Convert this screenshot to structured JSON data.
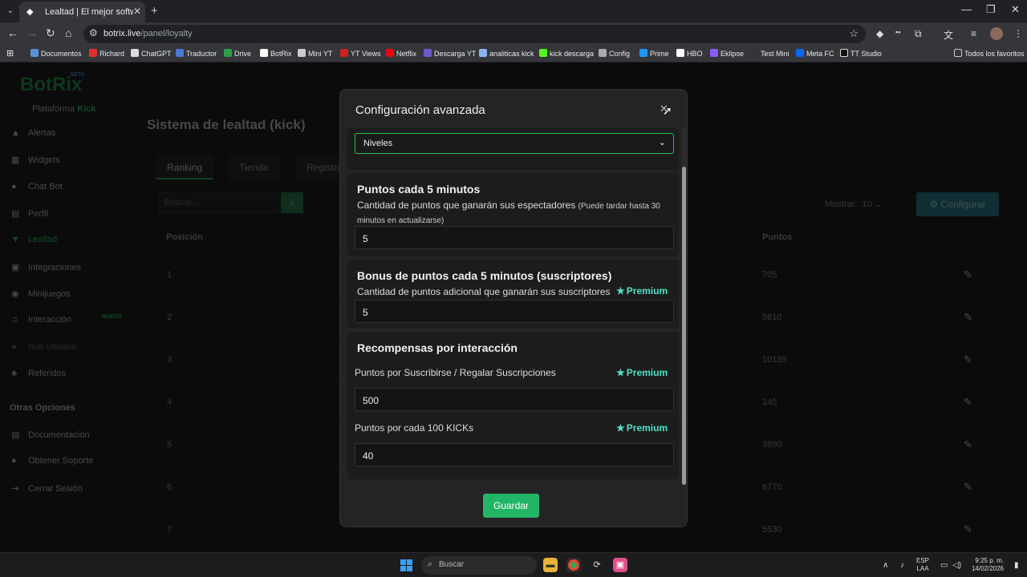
{
  "browser": {
    "tab_title": "Lealtad | El mejor software para",
    "url_domain": "botrix.live",
    "url_path": "/panel/loyalty",
    "bookmarks": [
      "Documentos",
      "Richard",
      "ChatGPT",
      "Traductor",
      "Drive",
      "BotRix",
      "Mini YT",
      "YT Views",
      "Netflix",
      "Descarga YT",
      "analiticas kick",
      "kick descarga",
      "Config",
      "Prime",
      "HBO",
      "Eklipse",
      "Test Mini",
      "Meta FC",
      "TT Studio"
    ],
    "all_bookmarks": "Todos los favoritos"
  },
  "sidebar": {
    "logo": "BotRix",
    "beta": "BETA",
    "platform_prefix": "Plataforma",
    "platform": "Kick",
    "items": [
      "Alertas",
      "Widgets",
      "Chat Bot",
      "Perfil",
      "Lealtad",
      "Integraciones",
      "Minijuegos",
      "Interacción",
      "Sub Usuario",
      "Referidos"
    ],
    "nuevo": "NUEVO",
    "other_heading": "Otras Opciones",
    "other": [
      "Documentación",
      "Obtener Soporte",
      "Cerrar Sesión"
    ]
  },
  "main": {
    "title": "Sistema de lealtad (kick)",
    "tabs": [
      "Ranking",
      "Tienda",
      "Registro"
    ],
    "search_placeholder": "Buscar...",
    "mostrar": "Mostrar:",
    "mostrar_value": "10",
    "configure": "Configurar",
    "col_position": "Posición",
    "col_points": "Puntos",
    "rows": [
      {
        "pos": "1",
        "points": "705"
      },
      {
        "pos": "2",
        "points": "5610"
      },
      {
        "pos": "3",
        "points": "10195"
      },
      {
        "pos": "4",
        "points": "145"
      },
      {
        "pos": "5",
        "points": "3890"
      },
      {
        "pos": "6",
        "points": "6770"
      },
      {
        "pos": "7",
        "points": "5530"
      }
    ]
  },
  "modal": {
    "title": "Configuración avanzada",
    "select_value": "Niveles",
    "s1_title": "Puntos cada 5 minutos",
    "s1_desc": "Cantidad de puntos que ganarán sus espectadores",
    "s1_note": "(Puede tardar hasta 30 minutos en actualizarse)",
    "s1_value": "5",
    "s2_title": "Bonus de puntos cada 5 minutos (suscriptores)",
    "s2_desc": "Cantidad de puntos adicional que ganarán sus suscriptores",
    "s2_value": "5",
    "premium": "Premium",
    "s3_title": "Recompensas por interacción",
    "s3_label1": "Puntos por Suscribirse / Regalar Suscripciones",
    "s3_value1": "500",
    "s3_label2": "Puntos por cada 100 KICKs",
    "s3_value2": "40",
    "save": "Guardar"
  },
  "taskbar": {
    "search": "Buscar",
    "lang1": "ESP",
    "lang2": "LAA",
    "time": "9:25 p. m.",
    "date": "14/02/2026"
  }
}
